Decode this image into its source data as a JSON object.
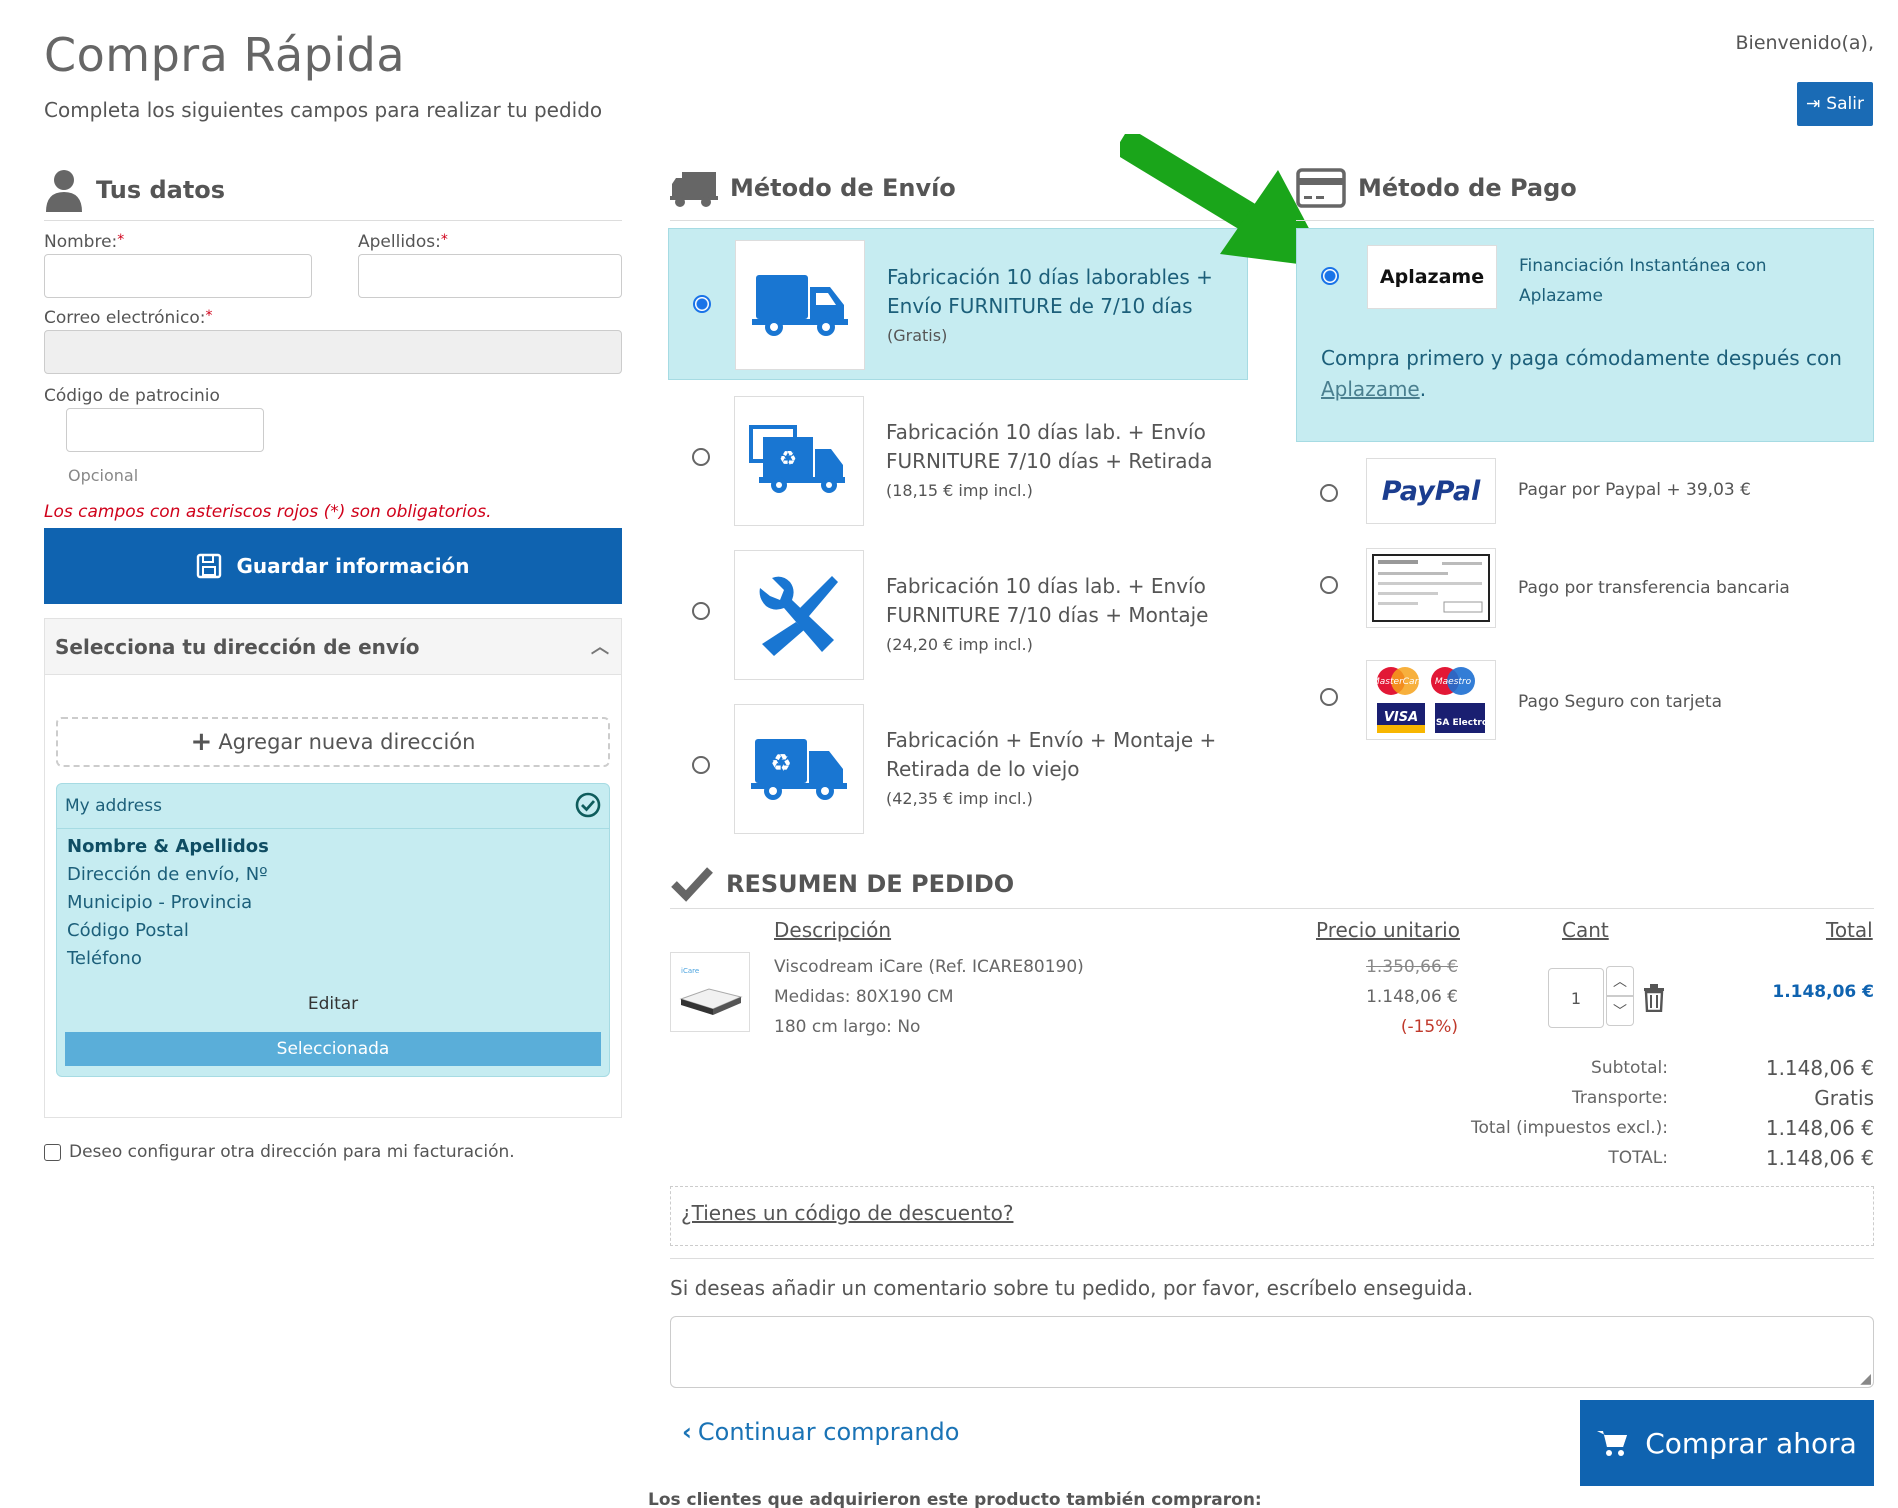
{
  "header": {
    "title": "Compra Rápida",
    "subtitle": "Completa los siguientes campos para realizar tu pedido",
    "welcome": "Bienvenido(a),",
    "logout_label": "Salir"
  },
  "user_data": {
    "title": "Tus datos",
    "first_name_label": "Nombre:",
    "last_name_label": "Apellidos:",
    "email_label": "Correo electrónico:",
    "referral_label": "Código de patrocinio",
    "optional_label": "Opcional",
    "required_note": "Los campos con asteriscos rojos (*) son obligatorios.",
    "required_mark": "*",
    "save_label": "Guardar información"
  },
  "address": {
    "panel_title": "Selecciona tu dirección de envío",
    "add_label": "Agregar nueva dirección",
    "card_title": "My address",
    "lines": [
      "Nombre & Apellidos",
      "Dirección de envío, Nº",
      "Municipio - Provincia",
      "Código Postal",
      "Teléfono"
    ],
    "edit_label": "Editar",
    "selected_label": "Seleccionada",
    "billing_checkbox_label": "Deseo configurar otra dirección para mi facturación."
  },
  "shipping": {
    "title": "Método de Envío",
    "options": [
      {
        "line1": "Fabricación 10 días laborables +",
        "line2": "Envío FURNITURE de 7/10 días",
        "price": "(Gratis)",
        "selected": true
      },
      {
        "line1": "Fabricación 10 días lab. + Envío",
        "line2": "FURNITURE 7/10 días + Retirada",
        "price": "(18,15 € imp incl.)",
        "selected": false
      },
      {
        "line1": "Fabricación 10 días lab. + Envío",
        "line2": "FURNITURE 7/10 días + Montaje",
        "price": "(24,20 € imp incl.)",
        "selected": false
      },
      {
        "line1": "Fabricación + Envío + Montaje +",
        "line2": "Retirada de lo viejo",
        "price": "(42,35 € imp incl.)",
        "selected": false
      }
    ]
  },
  "payment": {
    "title": "Método de Pago",
    "aplazame_logo": "Aplazame",
    "aplazame_line1": "Financiación Instantánea con",
    "aplazame_line2": "Aplazame",
    "aplazame_desc": "Compra primero y paga cómodamente después con",
    "aplazame_link": "Aplazame",
    "aplazame_period": ".",
    "paypal_logo": "PayPal",
    "paypal_label": "Pagar por Paypal + 39,03 €",
    "transfer_label": "Pago por transferencia bancaria",
    "card_label": "Pago Seguro con tarjeta",
    "card_logos": [
      "MasterCard",
      "Maestro",
      "VISA",
      "VISA Electron"
    ]
  },
  "summary": {
    "title": "RESUMEN DE PEDIDO",
    "col_desc": "Descripción",
    "col_price": "Precio unitario",
    "col_qty": "Cant",
    "col_total": "Total",
    "item": {
      "name": "Viscodream iCare (Ref. ICARE80190)",
      "size": "Medidas: 80X190 CM",
      "length": "180 cm largo: No",
      "old_price": "1.350,66 €",
      "price": "1.148,06 €",
      "discount": "(-15%)",
      "qty": "1",
      "total": "1.148,06 €",
      "thumb_label": "iCare"
    },
    "subtotal_label": "Subtotal:",
    "subtotal": "1.148,06 €",
    "transport_label": "Transporte:",
    "transport": "Gratis",
    "total_excl_label": "Total (impuestos excl.):",
    "total_excl": "1.148,06 €",
    "total_label": "TOTAL:",
    "total": "1.148,06 €"
  },
  "footer": {
    "discount_link": "¿Tienes un código de descuento?",
    "comment_prompt": "Si deseas añadir un comentario sobre tu pedido, por favor, escríbelo enseguida.",
    "continue_label": "Continuar comprando",
    "buy_label": "Comprar ahora",
    "also_bought": "Los clientes que adquirieron este producto también compraron:"
  },
  "colors": {
    "primary": "#0f63b0",
    "selected_bg": "#c6ecf1",
    "arrow": "#1aa51a",
    "required": "#d0021b"
  }
}
